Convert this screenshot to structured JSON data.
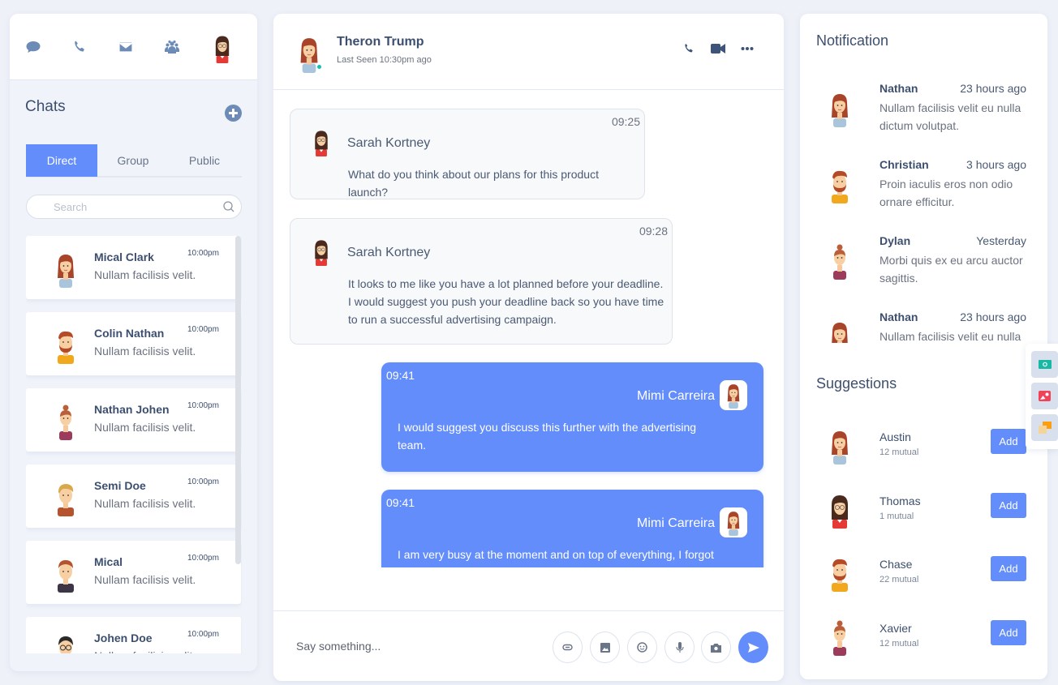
{
  "colors": {
    "accent": "#638dfb",
    "icon": "#6d8bb7",
    "text_dark": "#3d4f6e",
    "online": "#12c0b0",
    "background": "#eef1f8"
  },
  "sidebar": {
    "top_icons": [
      "chat-bubble-icon",
      "phone-icon",
      "mail-icon",
      "group-icon",
      "user-avatar"
    ],
    "title": "Chats",
    "add_icon": "plus-circle-icon",
    "tabs": [
      {
        "label": "Direct",
        "active": true
      },
      {
        "label": "Group",
        "active": false
      },
      {
        "label": "Public",
        "active": false
      }
    ],
    "search": {
      "placeholder": "Search",
      "value": "",
      "icon": "search-icon"
    },
    "chats": [
      {
        "name": "Mical Clark",
        "time": "10:00pm",
        "preview": "Nullam facilisis velit.",
        "avatar": "woman-long-hair"
      },
      {
        "name": "Colin Nathan",
        "time": "10:00pm",
        "preview": "Nullam facilisis velit.",
        "avatar": "man-beard"
      },
      {
        "name": "Nathan Johen",
        "time": "10:00pm",
        "preview": "Nullam facilisis velit.",
        "avatar": "woman-bun"
      },
      {
        "name": "Semi Doe",
        "time": "10:00pm",
        "preview": "Nullam facilisis velit.",
        "avatar": "man-blond"
      },
      {
        "name": "Mical",
        "time": "10:00pm",
        "preview": "Nullam facilisis velit.",
        "avatar": "man-dark-shirt"
      },
      {
        "name": "Johen Doe",
        "time": "10:00pm",
        "preview": "Nullam facilisis velit.",
        "avatar": "man-glasses"
      }
    ]
  },
  "chat": {
    "contact": {
      "name": "Theron Trump",
      "status": "Last Seen 10:30pm ago",
      "online": true
    },
    "actions": [
      "phone-icon",
      "video-icon",
      "more-icon"
    ],
    "messages": [
      {
        "direction": "in",
        "time": "09:25",
        "sender": "Sarah Kortney",
        "text": "What do you think about our plans for this product launch?"
      },
      {
        "direction": "in",
        "time": "09:28",
        "sender": "Sarah Kortney",
        "text": "It looks to me like you have a lot planned before your deadline. I would suggest you push your deadline back so you have time to run a successful advertising campaign."
      },
      {
        "direction": "out",
        "time": "09:41",
        "sender": "Mimi Carreira",
        "text": "I would suggest you discuss this further with the advertising team."
      },
      {
        "direction": "out",
        "time": "09:41",
        "sender": "Mimi Carreira",
        "text": "I am very busy at the moment and on top of everything, I forgot"
      }
    ],
    "composer": {
      "placeholder": "Say something...",
      "value": "",
      "buttons": [
        "link-icon",
        "image-icon",
        "emoji-icon",
        "mic-icon",
        "camera-icon",
        "send-icon"
      ]
    }
  },
  "right": {
    "notification_title": "Notification",
    "notifications": [
      {
        "name": "Nathan",
        "time": "23 hours ago",
        "text": "Nullam facilisis velit eu nulla dictum volutpat.",
        "avatar": "woman-long-hair"
      },
      {
        "name": "Christian",
        "time": "3 hours ago",
        "text": "Proin iaculis eros non odio ornare efficitur.",
        "avatar": "man-beard"
      },
      {
        "name": "Dylan",
        "time": "Yesterday",
        "text": "Morbi quis ex eu arcu auctor sagittis.",
        "avatar": "woman-bun"
      },
      {
        "name": "Nathan",
        "time": "23 hours ago",
        "text": "Nullam facilisis velit eu nulla",
        "avatar": "woman-long-hair"
      }
    ],
    "suggestions_title": "Suggestions",
    "suggestions": [
      {
        "name": "Austin",
        "mutual": "12 mutual",
        "button": "Add",
        "avatar": "woman-long-hair"
      },
      {
        "name": "Thomas",
        "mutual": "1 mutual",
        "button": "Add",
        "avatar": "woman-glasses"
      },
      {
        "name": "Chase",
        "mutual": "22 mutual",
        "button": "Add",
        "avatar": "man-beard"
      },
      {
        "name": "Xavier",
        "mutual": "12 mutual",
        "button": "Add",
        "avatar": "woman-bun"
      }
    ]
  },
  "floating_toolbar": [
    "money-icon",
    "gallery-icon",
    "chat-cards-icon"
  ]
}
